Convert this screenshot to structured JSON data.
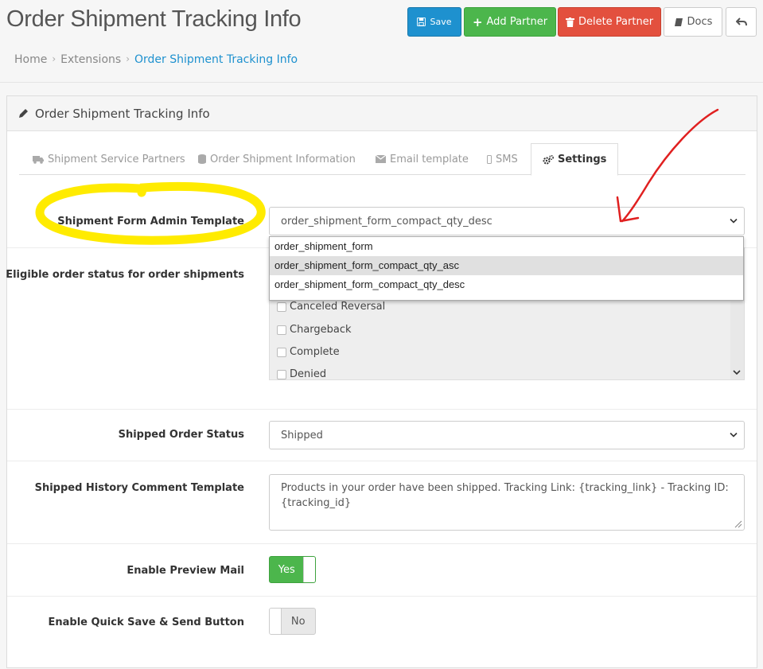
{
  "page": {
    "title": "Order Shipment Tracking Info"
  },
  "toolbar": {
    "save_label": "Save",
    "add_label": "Add Partner",
    "delete_label": "Delete Partner",
    "docs_label": "Docs"
  },
  "breadcrumb": [
    "Home",
    "Extensions",
    "Order Shipment Tracking Info"
  ],
  "panel": {
    "heading": "Order Shipment Tracking Info"
  },
  "tabs": [
    {
      "label": "Shipment Service Partners",
      "icon": "truck-icon"
    },
    {
      "label": "Order Shipment Information",
      "icon": "database-icon"
    },
    {
      "label": "Email template",
      "icon": "envelope-icon"
    },
    {
      "label": "SMS",
      "icon": "mobile-icon"
    },
    {
      "label": "Settings",
      "icon": "gears-icon",
      "active": true
    }
  ],
  "form": {
    "template_label": "Shipment Form Admin Template",
    "template_value": "order_shipment_form_compact_qty_desc",
    "template_options": [
      "order_shipment_form",
      "order_shipment_form_compact_qty_asc",
      "order_shipment_form_compact_qty_desc"
    ],
    "eligible_label": "Eligible order status for order shipments",
    "eligible_statuses": [
      "Canceled Reversal",
      "Chargeback",
      "Complete",
      "Denied"
    ],
    "shipped_status_label": "Shipped Order Status",
    "shipped_status_value": "Shipped",
    "comment_label": "Shipped History Comment Template",
    "comment_value": "Products in your order have been shipped. Tracking Link: {tracking_link} - Tracking ID: {tracking_id}",
    "preview_mail_label": "Enable Preview Mail",
    "preview_mail_value": "Yes",
    "quick_save_label": "Enable Quick Save & Send Button",
    "quick_save_value": "No"
  },
  "colors": {
    "primary": "#1e91cf",
    "success": "#4cb64c",
    "danger": "#e3503e",
    "highlight_marker": "#ffeb00",
    "annotation_arrow": "#e02020"
  }
}
